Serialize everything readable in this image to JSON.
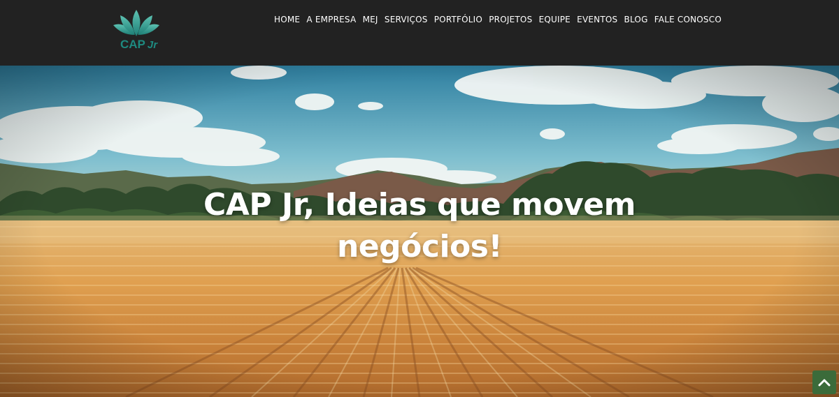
{
  "header": {
    "logo_text": "CAP",
    "logo_suffix": "Jr",
    "brand_color": "#1e8a80",
    "background": "#222222"
  },
  "nav": {
    "items": [
      {
        "label": "HOME"
      },
      {
        "label": "A EMPRESA"
      },
      {
        "label": "MEJ"
      },
      {
        "label": "SERVIÇOS"
      },
      {
        "label": "PORTFÓLIO"
      },
      {
        "label": "PROJETOS"
      },
      {
        "label": "EQUIPE"
      },
      {
        "label": "EVENTOS"
      },
      {
        "label": "BLOG"
      },
      {
        "label": "FALE CONOSCO"
      }
    ]
  },
  "hero": {
    "title_line1": "CAP Jr, Ideias que movem",
    "title_line2": "negócios!",
    "image": "wheat-field-landscape"
  },
  "scroll_top": {
    "icon": "chevron-up-icon",
    "color": "#3b6b3a"
  }
}
